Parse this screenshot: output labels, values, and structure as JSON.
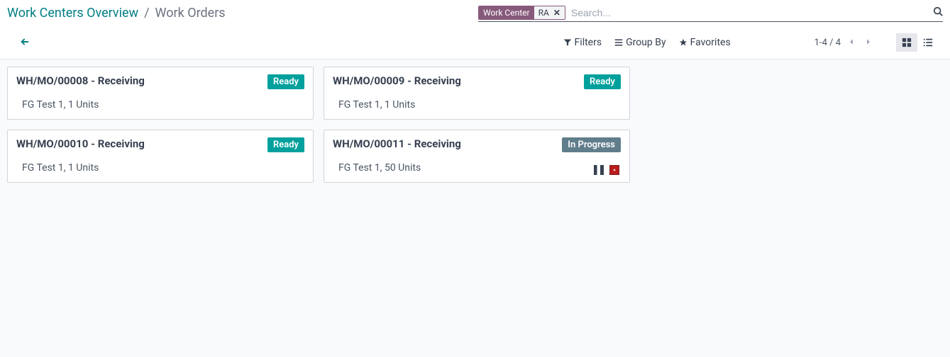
{
  "breadcrumb": {
    "link": "Work Centers Overview",
    "sep": "/",
    "current": "Work Orders"
  },
  "search": {
    "facet_label": "Work Center",
    "facet_value": "RA",
    "facet_remove": "✕",
    "placeholder": "Search..."
  },
  "toolbar": {
    "filters": "Filters",
    "groupby": "Group By",
    "favorites": "Favorites",
    "pager": "1-4 / 4"
  },
  "cards": [
    {
      "title": "WH/MO/00008 - Receiving",
      "sub": "FG Test 1,  1 Units",
      "status": "Ready",
      "status_kind": "ready",
      "icons": false
    },
    {
      "title": "WH/MO/00009 - Receiving",
      "sub": "FG Test 1,  1 Units",
      "status": "Ready",
      "status_kind": "ready",
      "icons": false
    },
    {
      "title": "WH/MO/00010 - Receiving",
      "sub": "FG Test 1,  1 Units",
      "status": "Ready",
      "status_kind": "ready",
      "icons": false
    },
    {
      "title": "WH/MO/00011 - Receiving",
      "sub": "FG Test 1,  50 Units",
      "status": "In Progress",
      "status_kind": "progress",
      "icons": true
    }
  ]
}
